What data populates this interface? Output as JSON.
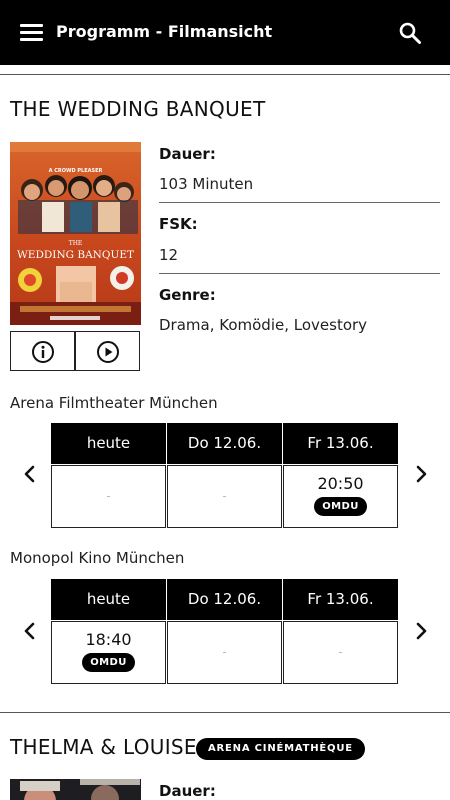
{
  "header": {
    "title": "Programm - Filmansicht",
    "menu_icon": "hamburger-menu-icon",
    "search_icon": "search-icon"
  },
  "movies": [
    {
      "title": "THE WEDDING BANQUET",
      "poster": {
        "top_tagline": "A CROWD PLEASER",
        "title_line1": "THE",
        "title_line2": "WEDDING BANQUET"
      },
      "buttons": {
        "info_icon": "info-icon",
        "trailer_icon": "play-icon"
      },
      "details": [
        {
          "label": "Dauer:",
          "value": "103 Minuten"
        },
        {
          "label": "FSK:",
          "value": "12"
        },
        {
          "label": "Genre:",
          "value": "Drama, Komödie, Lovestory"
        }
      ],
      "cinemas": [
        {
          "name": "Arena Filmtheater München",
          "days": [
            "heute",
            "Do 12.06.",
            "Fr 13.06."
          ],
          "slots": [
            {
              "time": "",
              "badge": "",
              "placeholder": "-"
            },
            {
              "time": "",
              "badge": "",
              "placeholder": "-"
            },
            {
              "time": "20:50",
              "badge": "OMDU",
              "placeholder": ""
            }
          ]
        },
        {
          "name": "Monopol Kino München",
          "days": [
            "heute",
            "Do 12.06.",
            "Fr 13.06."
          ],
          "slots": [
            {
              "time": "18:40",
              "badge": "OMDU",
              "placeholder": ""
            },
            {
              "time": "",
              "badge": "",
              "placeholder": "-"
            },
            {
              "time": "",
              "badge": "",
              "placeholder": "-"
            }
          ]
        }
      ]
    },
    {
      "title": "THELMA & LOUISE",
      "venue_badge": "ARENA CINÉMATHÈQUE",
      "details": [
        {
          "label": "Dauer:"
        }
      ]
    }
  ]
}
